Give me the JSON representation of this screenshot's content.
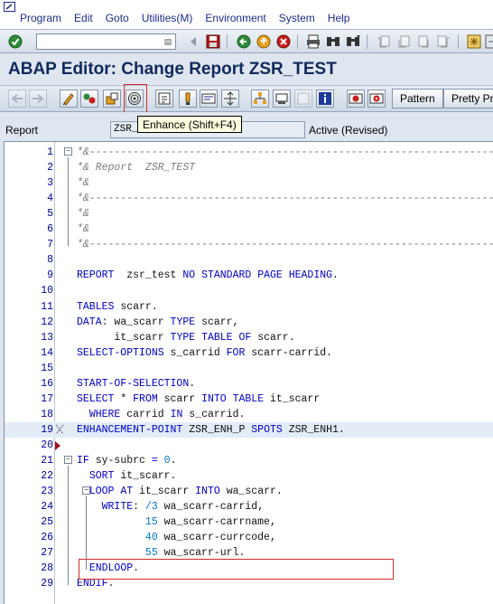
{
  "menu": {
    "items": [
      "Program",
      "Edit",
      "Goto",
      "Utilities(M)",
      "Environment",
      "System",
      "Help"
    ]
  },
  "system_toolbar": {
    "command_placeholder": "",
    "icons": [
      "enter-icon",
      "back-icon",
      "save-icon",
      "back-arrow-icon",
      "exit-icon",
      "cancel-icon",
      "print-icon",
      "find-icon",
      "find-next-icon",
      "first-page-icon",
      "previous-page-icon",
      "next-page-icon",
      "last-page-icon",
      "create-session-icon",
      "shortcut-icon"
    ]
  },
  "title": "ABAP Editor: Change Report ZSR_TEST",
  "app_toolbar": {
    "pattern_label": "Pattern",
    "pretty_printer_label": "Pretty Pri"
  },
  "header": {
    "report_label": "Report",
    "report_value": "ZSR_",
    "status": "Active (Revised)"
  },
  "tooltip": "Enhance  (Shift+F4)",
  "editor": {
    "lines": [
      {
        "n": "1",
        "text": "*&---------------------------------------------------------------------"
      },
      {
        "n": "2",
        "text": "*& Report  ZSR_TEST"
      },
      {
        "n": "3",
        "text": "*&"
      },
      {
        "n": "4",
        "text": "*&---------------------------------------------------------------------"
      },
      {
        "n": "5",
        "text": "*&"
      },
      {
        "n": "6",
        "text": "*&"
      },
      {
        "n": "7",
        "text": "*&---------------------------------------------------------------------"
      },
      {
        "n": "8",
        "text": ""
      },
      {
        "n": "9",
        "text": "REPORT  zsr_test NO STANDARD PAGE HEADING."
      },
      {
        "n": "10",
        "text": ""
      },
      {
        "n": "11",
        "text": "TABLES scarr."
      },
      {
        "n": "12",
        "text": "DATA: wa_scarr TYPE scarr,"
      },
      {
        "n": "13",
        "text": "      it_scarr TYPE TABLE OF scarr."
      },
      {
        "n": "14",
        "text": "SELECT-OPTIONS s_carrid FOR scarr-carrid."
      },
      {
        "n": "15",
        "text": ""
      },
      {
        "n": "16",
        "text": "START-OF-SELECTION."
      },
      {
        "n": "17",
        "text": "SELECT * FROM scarr INTO TABLE it_scarr"
      },
      {
        "n": "18",
        "text": "  WHERE carrid IN s_carrid."
      },
      {
        "n": "19",
        "text": "ENHANCEMENT-POINT ZSR_ENH_P SPOTS ZSR_ENH1."
      },
      {
        "n": "20",
        "text": ""
      },
      {
        "n": "21",
        "text": "IF sy-subrc = 0."
      },
      {
        "n": "22",
        "text": "  SORT it_scarr."
      },
      {
        "n": "23",
        "text": "  LOOP AT it_scarr INTO wa_scarr."
      },
      {
        "n": "24",
        "text": "    WRITE: /3 wa_scarr-carrid,"
      },
      {
        "n": "25",
        "text": "           15 wa_scarr-carrname,"
      },
      {
        "n": "26",
        "text": "           40 wa_scarr-currcode,"
      },
      {
        "n": "27",
        "text": "           55 wa_scarr-url."
      },
      {
        "n": "28",
        "text": "  ENDLOOP."
      },
      {
        "n": "29",
        "text": "ENDIF."
      }
    ]
  }
}
